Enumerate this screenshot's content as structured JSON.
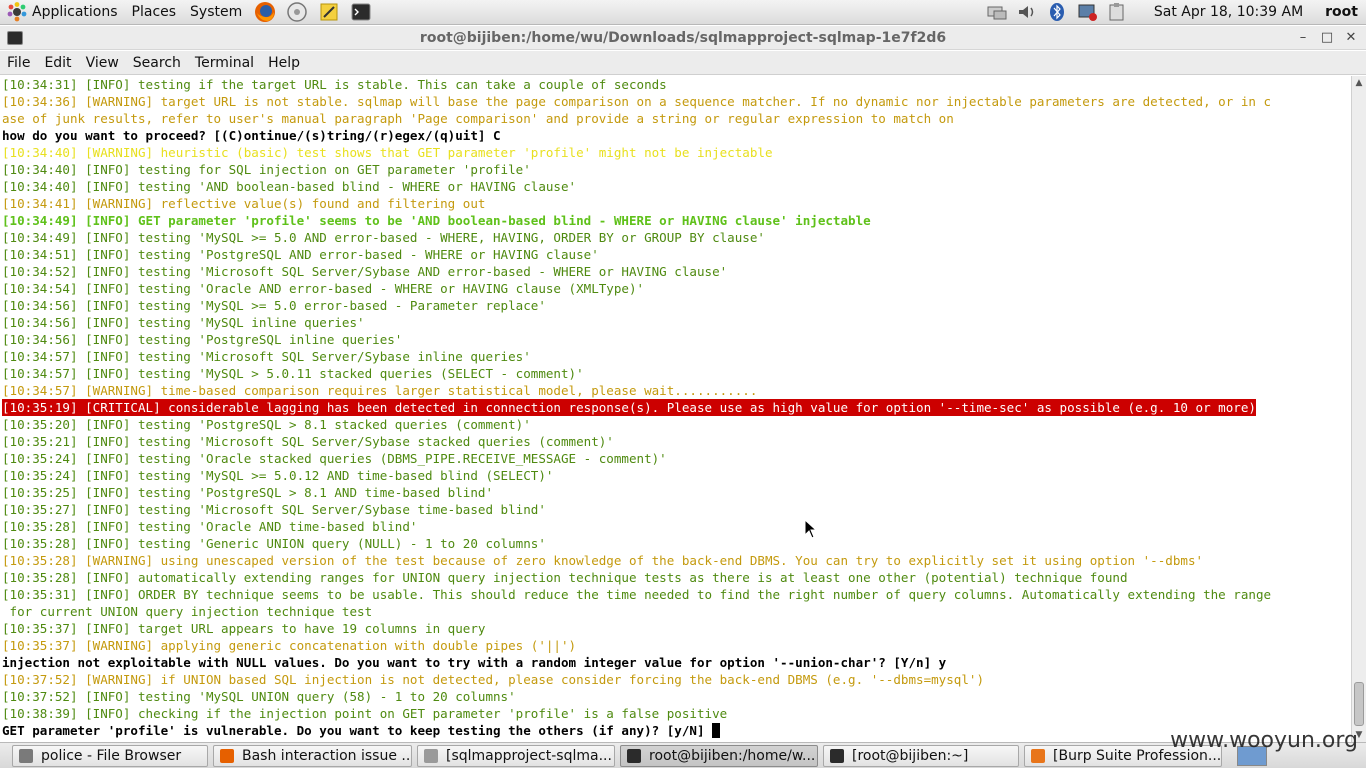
{
  "top_panel": {
    "menus": [
      "Applications",
      "Places",
      "System"
    ],
    "launchers": [
      "firefox-icon",
      "gear-settings-icon",
      "notes-icon",
      "terminal-icon"
    ],
    "tray_icons": [
      "network-icon",
      "volume-icon",
      "bluetooth-icon",
      "network-manager-icon",
      "clipboard-icon"
    ],
    "clock": "Sat Apr 18, 10:39 AM",
    "user": "root"
  },
  "window": {
    "title": "root@bijiben:/home/wu/Downloads/sqlmapproject-sqlmap-1e7f2d6",
    "controls": {
      "minimize": "–",
      "maximize": "□",
      "close": "✕"
    }
  },
  "menubar": [
    "File",
    "Edit",
    "View",
    "Search",
    "Terminal",
    "Help"
  ],
  "terminal_lines": [
    {
      "type": "info",
      "text": "[10:34:31] [INFO] testing if the target URL is stable. This can take a couple of seconds"
    },
    {
      "type": "warn",
      "text": "[10:34:36] [WARNING] target URL is not stable. sqlmap will base the page comparison on a sequence matcher. If no dynamic nor injectable parameters are detected, or in c"
    },
    {
      "type": "warn",
      "text": "ase of junk results, refer to user's manual paragraph 'Page comparison' and provide a string or regular expression to match on"
    },
    {
      "type": "prompt",
      "text": "how do you want to proceed? [(C)ontinue/(s)tring/(r)egex/(q)uit] C"
    },
    {
      "type": "yellow",
      "text": "[10:34:40] [WARNING] heuristic (basic) test shows that GET parameter 'profile' might not be injectable"
    },
    {
      "type": "info",
      "text": "[10:34:40] [INFO] testing for SQL injection on GET parameter 'profile'"
    },
    {
      "type": "info",
      "text": "[10:34:40] [INFO] testing 'AND boolean-based blind - WHERE or HAVING clause'"
    },
    {
      "type": "warn",
      "text": "[10:34:41] [WARNING] reflective value(s) found and filtering out"
    },
    {
      "type": "bold-green",
      "text": "[10:34:49] [INFO] GET parameter 'profile' seems to be 'AND boolean-based blind - WHERE or HAVING clause' injectable"
    },
    {
      "type": "info",
      "text": "[10:34:49] [INFO] testing 'MySQL >= 5.0 AND error-based - WHERE, HAVING, ORDER BY or GROUP BY clause'"
    },
    {
      "type": "info",
      "text": "[10:34:51] [INFO] testing 'PostgreSQL AND error-based - WHERE or HAVING clause'"
    },
    {
      "type": "info",
      "text": "[10:34:52] [INFO] testing 'Microsoft SQL Server/Sybase AND error-based - WHERE or HAVING clause'"
    },
    {
      "type": "info",
      "text": "[10:34:54] [INFO] testing 'Oracle AND error-based - WHERE or HAVING clause (XMLType)'"
    },
    {
      "type": "info",
      "text": "[10:34:56] [INFO] testing 'MySQL >= 5.0 error-based - Parameter replace'"
    },
    {
      "type": "info",
      "text": "[10:34:56] [INFO] testing 'MySQL inline queries'"
    },
    {
      "type": "info",
      "text": "[10:34:56] [INFO] testing 'PostgreSQL inline queries'"
    },
    {
      "type": "info",
      "text": "[10:34:57] [INFO] testing 'Microsoft SQL Server/Sybase inline queries'"
    },
    {
      "type": "info",
      "text": "[10:34:57] [INFO] testing 'MySQL > 5.0.11 stacked queries (SELECT - comment)'"
    },
    {
      "type": "warn",
      "text": "[10:34:57] [WARNING] time-based comparison requires larger statistical model, please wait..........."
    },
    {
      "type": "critical",
      "text": "[10:35:19] [CRITICAL] considerable lagging has been detected in connection response(s). Please use as high value for option '--time-sec' as possible (e.g. 10 or more)"
    },
    {
      "type": "info",
      "text": "[10:35:20] [INFO] testing 'PostgreSQL > 8.1 stacked queries (comment)'"
    },
    {
      "type": "info",
      "text": "[10:35:21] [INFO] testing 'Microsoft SQL Server/Sybase stacked queries (comment)'"
    },
    {
      "type": "info",
      "text": "[10:35:24] [INFO] testing 'Oracle stacked queries (DBMS_PIPE.RECEIVE_MESSAGE - comment)'"
    },
    {
      "type": "info",
      "text": "[10:35:24] [INFO] testing 'MySQL >= 5.0.12 AND time-based blind (SELECT)'"
    },
    {
      "type": "info",
      "text": "[10:35:25] [INFO] testing 'PostgreSQL > 8.1 AND time-based blind'"
    },
    {
      "type": "info",
      "text": "[10:35:27] [INFO] testing 'Microsoft SQL Server/Sybase time-based blind'"
    },
    {
      "type": "info",
      "text": "[10:35:28] [INFO] testing 'Oracle AND time-based blind'"
    },
    {
      "type": "info",
      "text": "[10:35:28] [INFO] testing 'Generic UNION query (NULL) - 1 to 20 columns'"
    },
    {
      "type": "warn",
      "text": "[10:35:28] [WARNING] using unescaped version of the test because of zero knowledge of the back-end DBMS. You can try to explicitly set it using option '--dbms'"
    },
    {
      "type": "info",
      "text": "[10:35:28] [INFO] automatically extending ranges for UNION query injection technique tests as there is at least one other (potential) technique found"
    },
    {
      "type": "info",
      "text": "[10:35:31] [INFO] ORDER BY technique seems to be usable. This should reduce the time needed to find the right number of query columns. Automatically extending the range"
    },
    {
      "type": "info",
      "text": " for current UNION query injection technique test"
    },
    {
      "type": "info",
      "text": "[10:35:37] [INFO] target URL appears to have 19 columns in query"
    },
    {
      "type": "warn",
      "text": "[10:35:37] [WARNING] applying generic concatenation with double pipes ('||')"
    },
    {
      "type": "prompt",
      "text": "injection not exploitable with NULL values. Do you want to try with a random integer value for option '--union-char'? [Y/n] y"
    },
    {
      "type": "warn",
      "text": "[10:37:52] [WARNING] if UNION based SQL injection is not detected, please consider forcing the back-end DBMS (e.g. '--dbms=mysql')"
    },
    {
      "type": "info",
      "text": "[10:37:52] [INFO] testing 'MySQL UNION query (58) - 1 to 20 columns'"
    },
    {
      "type": "info",
      "text": "[10:38:39] [INFO] checking if the injection point on GET parameter 'profile' is a false positive"
    },
    {
      "type": "prompt",
      "text": "GET parameter 'profile' is vulnerable. Do you want to keep testing the others (if any)? [y/N] "
    }
  ],
  "colors": {
    "info": "#4f8a10",
    "warning": "#c49a0e",
    "critical_bg": "#cc0000"
  },
  "taskbar": [
    {
      "label": "police - File Browser",
      "icon": "file-browser-icon",
      "active": false,
      "width": 196
    },
    {
      "label": "Bash interaction issue ...",
      "icon": "firefox-icon",
      "active": false,
      "width": 199
    },
    {
      "label": "[sqlmapproject-sqlma...",
      "icon": "folder-icon",
      "active": false,
      "width": 198
    },
    {
      "label": "root@bijiben:/home/w...",
      "icon": "terminal-icon",
      "active": true,
      "width": 198
    },
    {
      "label": "[root@bijiben:~]",
      "icon": "terminal-icon",
      "active": false,
      "width": 196
    },
    {
      "label": "[Burp Suite Profession...",
      "icon": "burp-icon",
      "active": false,
      "width": 198
    }
  ],
  "watermark": "www.wooyun.org"
}
